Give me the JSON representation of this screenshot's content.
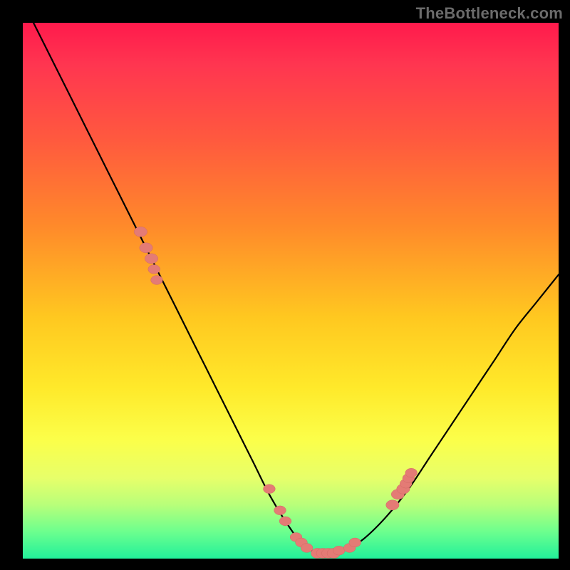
{
  "watermark": "TheBottleneck.com",
  "chart_data": {
    "type": "line",
    "title": "",
    "xlabel": "",
    "ylabel": "",
    "xlim": [
      0,
      100
    ],
    "ylim": [
      0,
      100
    ],
    "grid": false,
    "legend": false,
    "series": [
      {
        "name": "bottleneck-curve",
        "x": [
          2,
          5,
          8,
          12,
          16,
          20,
          24,
          28,
          32,
          36,
          40,
          43,
          46,
          49,
          52,
          55,
          58,
          61,
          64,
          68,
          72,
          76,
          80,
          84,
          88,
          92,
          96,
          100
        ],
        "y": [
          100,
          94,
          88,
          80,
          72,
          64,
          56,
          48,
          40,
          32,
          24,
          18,
          12,
          7,
          3,
          1,
          1,
          2,
          4,
          8,
          13,
          19,
          25,
          31,
          37,
          43,
          48,
          53
        ]
      }
    ],
    "markers": [
      {
        "x": 22,
        "y": 61,
        "r": 2.2
      },
      {
        "x": 23,
        "y": 58,
        "r": 2.2
      },
      {
        "x": 24,
        "y": 56,
        "r": 2.2
      },
      {
        "x": 24.5,
        "y": 54,
        "r": 2.0
      },
      {
        "x": 25,
        "y": 52,
        "r": 2.0
      },
      {
        "x": 46,
        "y": 13,
        "r": 2.0
      },
      {
        "x": 48,
        "y": 9,
        "r": 2.0
      },
      {
        "x": 49,
        "y": 7,
        "r": 2.0
      },
      {
        "x": 51,
        "y": 4,
        "r": 2.0
      },
      {
        "x": 52,
        "y": 3,
        "r": 2.0
      },
      {
        "x": 53,
        "y": 2,
        "r": 2.0
      },
      {
        "x": 55,
        "y": 1,
        "r": 2.2
      },
      {
        "x": 56,
        "y": 1,
        "r": 2.2
      },
      {
        "x": 57,
        "y": 1,
        "r": 2.2
      },
      {
        "x": 58,
        "y": 1,
        "r": 2.2
      },
      {
        "x": 59,
        "y": 1.5,
        "r": 2.0
      },
      {
        "x": 61,
        "y": 2,
        "r": 2.0
      },
      {
        "x": 62,
        "y": 3,
        "r": 2.0
      },
      {
        "x": 69,
        "y": 10,
        "r": 2.2
      },
      {
        "x": 70,
        "y": 12,
        "r": 2.2
      },
      {
        "x": 71,
        "y": 13,
        "r": 2.2
      },
      {
        "x": 71.5,
        "y": 14,
        "r": 2.0
      },
      {
        "x": 72,
        "y": 15,
        "r": 2.0
      },
      {
        "x": 72.5,
        "y": 16,
        "r": 2.0
      }
    ]
  }
}
